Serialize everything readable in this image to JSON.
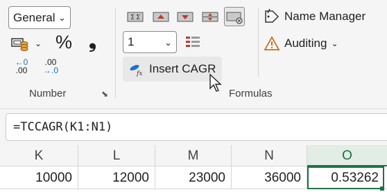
{
  "ribbon": {
    "number_group": {
      "format_value": "General",
      "percent_symbol": "%",
      "comma_symbol": "❟",
      "increase_decimal_top": "←0",
      "increase_decimal_bottom": ".00",
      "decrease_decimal_top": ".00",
      "decrease_decimal_bottom": "→.0",
      "label": "Number"
    },
    "formulas_group": {
      "number_value": "1",
      "insert_cagr_label": "Insert CAGR",
      "name_manager_label": "Name Manager",
      "auditing_label": "Auditing",
      "label": "Formulas"
    }
  },
  "formula_bar": {
    "value": "=TCCAGR(K1:N1)"
  },
  "grid": {
    "columns": [
      "K",
      "L",
      "M",
      "N",
      "O"
    ],
    "row": [
      "10000",
      "12000",
      "23000",
      "36000",
      "0.53262"
    ]
  },
  "colors": {
    "accent_green": "#1e7145",
    "ribbon_bg": "#f5f5f5",
    "arrow_blue": "#1a73c8",
    "icon_red": "#c0392b"
  }
}
